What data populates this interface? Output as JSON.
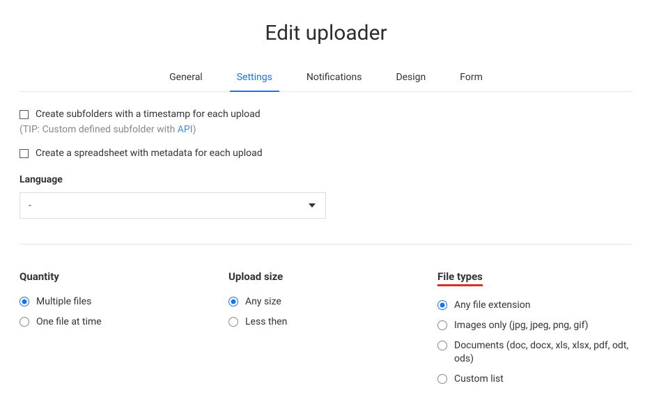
{
  "title": "Edit uploader",
  "tabs": {
    "general": "General",
    "settings": "Settings",
    "notifications": "Notifications",
    "design": "Design",
    "form": "Form"
  },
  "activeTab": "settings",
  "checkboxes": {
    "createSubfolders": "Create subfolders with a timestamp for each upload",
    "tipPrefix": "(TIP: Custom defined subfolder with ",
    "apiLink": "API",
    "tipSuffix": ")",
    "createSpreadsheet": "Create a spreadsheet with metadata for each upload"
  },
  "language": {
    "label": "Language",
    "selected": "-"
  },
  "quantity": {
    "title": "Quantity",
    "options": {
      "multiple": "Multiple files",
      "one": "One file at time"
    }
  },
  "uploadSize": {
    "title": "Upload size",
    "options": {
      "any": "Any size",
      "less": "Less then"
    }
  },
  "fileTypes": {
    "title": "File types",
    "options": {
      "any": "Any file extension",
      "images": "Images only (jpg, jpeg, png, gif)",
      "documents": "Documents (doc, docx, xls, xlsx, pdf, odt, ods)",
      "custom": "Custom list"
    }
  }
}
